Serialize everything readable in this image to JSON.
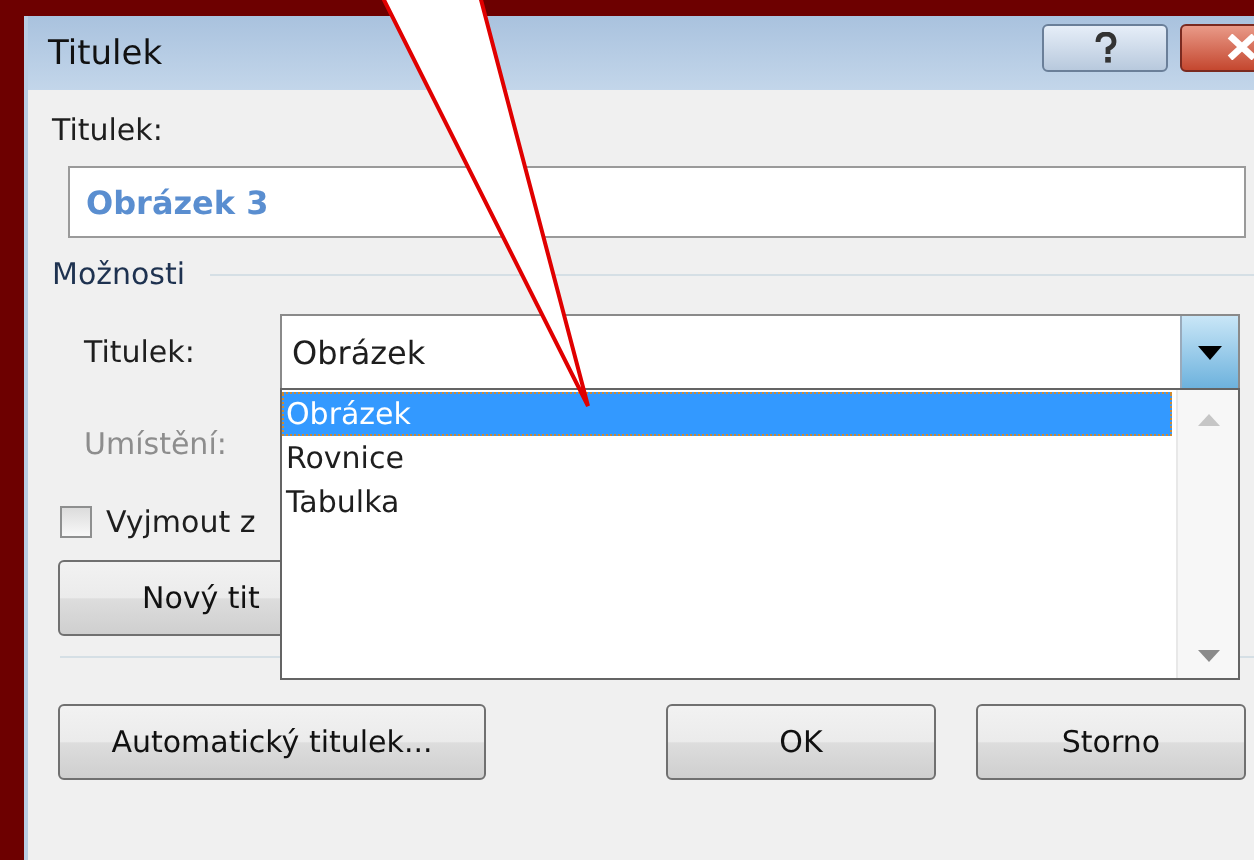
{
  "window": {
    "title": "Titulek"
  },
  "caption_field": {
    "label": "Titulek:",
    "value": "Obrázek 3"
  },
  "options": {
    "heading": "Možnosti",
    "caption_combo": {
      "label": "Titulek:",
      "value": "Obrázek",
      "expanded": true,
      "items": [
        {
          "label": "Obrázek",
          "selected": true
        },
        {
          "label": "Rovnice",
          "selected": false
        },
        {
          "label": "Tabulka",
          "selected": false
        }
      ]
    },
    "position": {
      "label": "Umístění:",
      "disabled": true
    },
    "exclude_checkbox": {
      "label": "Vyjmout z",
      "checked": false
    },
    "new_button": "Nový tit"
  },
  "buttons": [
    {
      "label": "Automatický titulek...",
      "kind": "left"
    },
    {
      "label": "OK",
      "kind": "right"
    },
    {
      "label": "Storno",
      "kind": "right"
    }
  ]
}
